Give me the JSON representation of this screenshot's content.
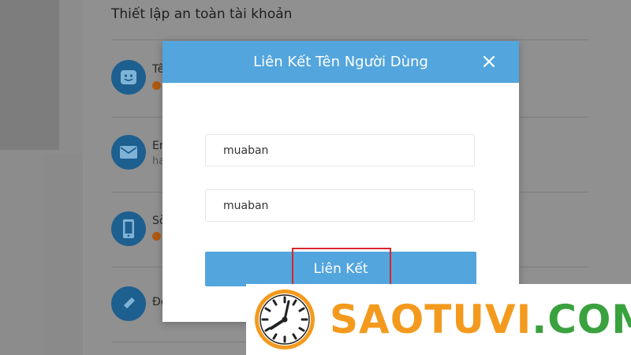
{
  "background": {
    "section_title": "Thiết lập an toàn tài khoản",
    "rows": [
      {
        "icon": "face-icon",
        "label": "Tê"
      },
      {
        "icon": "mail-icon",
        "label": "Em",
        "sub": "ha"
      },
      {
        "icon": "phone-icon",
        "label": "Sò"
      },
      {
        "icon": "pencil-icon",
        "label": "Đo"
      }
    ]
  },
  "modal": {
    "title": "Liên Kết Tên Người Dùng",
    "close_icon": "close-icon",
    "fields": [
      {
        "value": "muaban"
      },
      {
        "value": "muaban"
      }
    ],
    "submit_label": "Liên Kết"
  },
  "watermark": {
    "brand_part1": "SAOTUVI",
    "brand_part2": ".COM",
    "colors": {
      "orange": "#f39a1e",
      "green": "#3aa13f"
    }
  },
  "colors": {
    "accent": "#53a5dd",
    "highlight": "#d9262c"
  }
}
